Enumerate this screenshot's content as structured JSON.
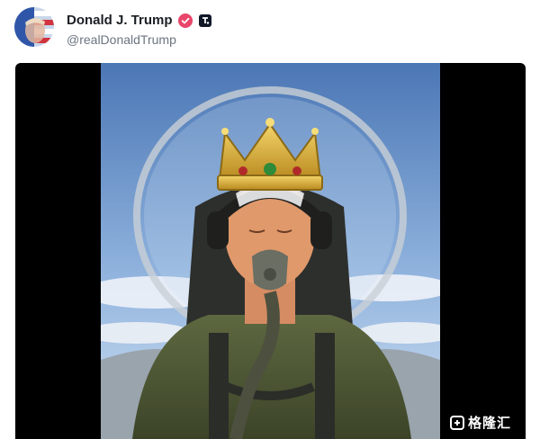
{
  "post": {
    "author_name": "Donald J. Trump",
    "handle": "@realDonaldTrump",
    "verified_icon": "verified-badge-icon",
    "platform_icon": "truth-social-icon"
  },
  "media": {
    "type": "image",
    "watermark": "格隆汇"
  },
  "colors": {
    "verified": "#e8466a",
    "platform": "#111827",
    "name_text": "#1b1f24",
    "handle_text": "#6b7480"
  }
}
